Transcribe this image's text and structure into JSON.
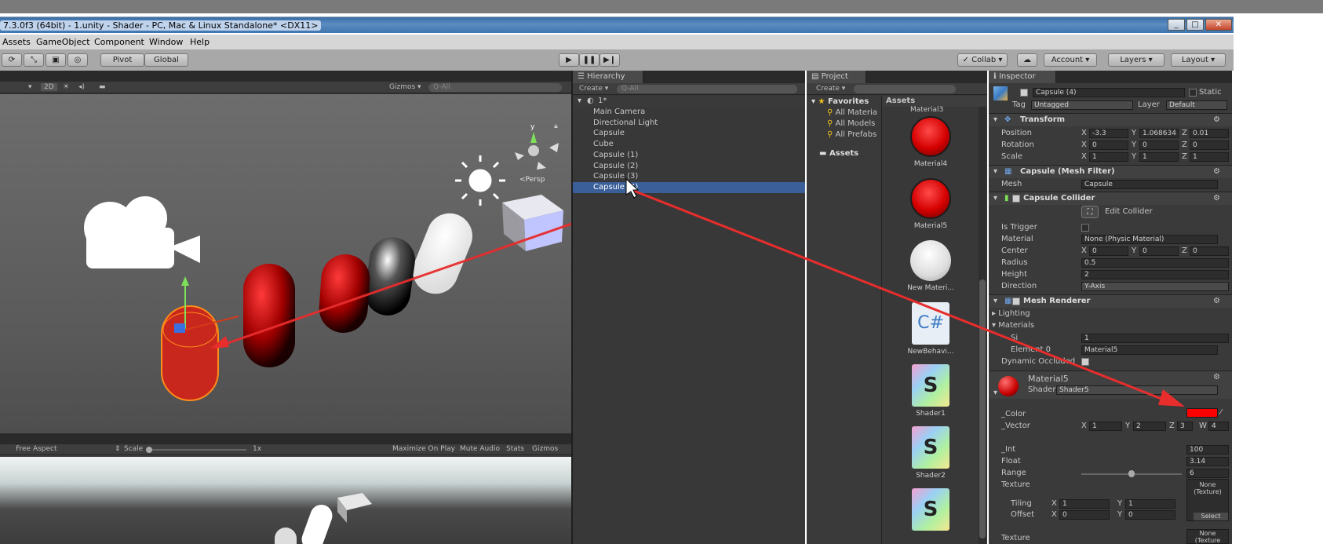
{
  "window": {
    "title": "7.3.0f3 (64bit) - 1.unity - Shader - PC, Mac & Linux Standalone* <DX11>"
  },
  "menu": [
    "Assets",
    "GameObject",
    "Component",
    "Window",
    "Help"
  ],
  "toolbar": {
    "pivot": "Pivot",
    "global": "Global",
    "collab": "Collab",
    "account": "Account",
    "layers": "Layers",
    "layout": "Layout"
  },
  "scene": {
    "mode_2d": "2D",
    "gizmos": "Gizmos",
    "search_placeholder": "Q-All",
    "persp": "<Persp"
  },
  "game": {
    "aspect": "Free Aspect",
    "scale_label": "Scale",
    "scale_value": "1x",
    "maximize": "Maximize On Play",
    "mute": "Mute Audio",
    "stats": "Stats",
    "gizmos": "Gizmos"
  },
  "hierarchy": {
    "tab": "Hierarchy",
    "create": "Create",
    "search": "Q-All",
    "scene_name": "1*",
    "items": [
      "Main Camera",
      "Directional Light",
      "Capsule",
      "Cube",
      "Capsule (1)",
      "Capsule (2)",
      "Capsule (3)",
      "Capsule (4)"
    ],
    "selected_index": 7
  },
  "project": {
    "tab": "Project",
    "create": "Create",
    "favorites": "Favorites",
    "fav_items": [
      "All Materia",
      "All Models",
      "All Prefabs"
    ],
    "assets_root": "Assets",
    "assets_header": "Assets",
    "top_label": "Material3",
    "assets": [
      {
        "name": "Material4",
        "kind": "red"
      },
      {
        "name": "Material5",
        "kind": "red"
      },
      {
        "name": "New Materi...",
        "kind": "white"
      },
      {
        "name": "NewBehavi...",
        "kind": "cs"
      },
      {
        "name": "Shader1",
        "kind": "shader"
      },
      {
        "name": "Shader2",
        "kind": "shader"
      },
      {
        "name": "",
        "kind": "shader"
      }
    ]
  },
  "inspector": {
    "tab": "Inspector",
    "object_name": "Capsule (4)",
    "static": "Static",
    "tag_label": "Tag",
    "tag": "Untagged",
    "layer_label": "Layer",
    "layer": "Default",
    "transform": {
      "title": "Transform",
      "position": {
        "label": "Position",
        "x": "-3.3",
        "y": "1.068634",
        "z": "0.01"
      },
      "rotation": {
        "label": "Rotation",
        "x": "0",
        "y": "0",
        "z": "0"
      },
      "scale": {
        "label": "Scale",
        "x": "1",
        "y": "1",
        "z": "1"
      }
    },
    "mesh_filter": {
      "title": "Capsule (Mesh Filter)",
      "mesh_label": "Mesh",
      "mesh": "Capsule"
    },
    "collider": {
      "title": "Capsule Collider",
      "edit": "Edit Collider",
      "is_trigger": "Is Trigger",
      "material_label": "Material",
      "material": "None (Physic Material)",
      "center_label": "Center",
      "cx": "0",
      "cy": "0",
      "cz": "0",
      "radius_label": "Radius",
      "radius": "0.5",
      "height_label": "Height",
      "height": "2",
      "direction_label": "Direction",
      "direction": "Y-Axis"
    },
    "renderer": {
      "title": "Mesh Renderer",
      "lighting": "Lighting",
      "materials": "Materials",
      "size_label": "Si",
      "size": "1",
      "element_label": "Element 0",
      "element": "Material5",
      "dyn": "Dynamic Occluded"
    },
    "material": {
      "name": "Material5",
      "shader_label": "Shader",
      "shader": "Shader5",
      "color_label": "_Color",
      "color": "#ff0000",
      "vector_label": "_Vector",
      "vx": "1",
      "vy": "2",
      "vz": "3",
      "vw": "4",
      "int_label": "_Int",
      "int": "100",
      "float_label": "Float",
      "float": "3.14",
      "range_label": "Range",
      "range": "6",
      "range_fraction": 0.5,
      "texture_label": "Texture",
      "texture_none": "None (Texture)",
      "select": "Select",
      "tiling_label": "Tiling",
      "tx": "1",
      "ty": "1",
      "offset_label": "Offset",
      "ox": "0",
      "oy": "0",
      "texture2_label": "Texture",
      "texture2_none": "None (Texture"
    }
  }
}
